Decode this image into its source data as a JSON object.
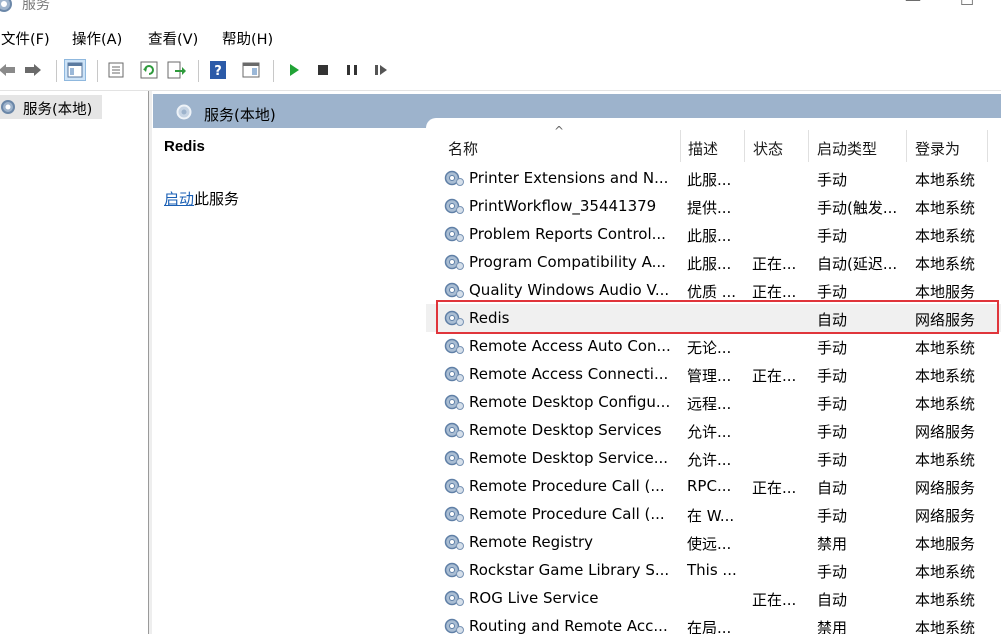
{
  "window": {
    "title": "服务"
  },
  "menu": [
    {
      "label": "文件(F)"
    },
    {
      "label": "操作(A)"
    },
    {
      "label": "查看(V)"
    },
    {
      "label": "帮助(H)"
    }
  ],
  "toolbar": {
    "buttons": [
      "back-icon",
      "forward-icon",
      "show-console-tree-icon",
      "properties-icon",
      "refresh-icon",
      "export-list-icon",
      "help-icon",
      "show-action-pane-icon",
      "start-service-icon",
      "stop-service-icon",
      "pause-service-icon",
      "resume-service-icon"
    ]
  },
  "tree": {
    "root_label": "服务(本地)"
  },
  "panel": {
    "header_title": "服务(本地)",
    "selected_service": "Redis",
    "start_link": "启动",
    "start_suffix": "此服务"
  },
  "columns": {
    "name": "名称",
    "desc": "描述",
    "status": "状态",
    "startup": "启动类型",
    "logon": "登录为"
  },
  "services": [
    {
      "name": "Printer Extensions and N...",
      "desc": "此服...",
      "status": "",
      "startup": "手动",
      "logon": "本地系统"
    },
    {
      "name": "PrintWorkflow_35441379",
      "desc": "提供...",
      "status": "",
      "startup": "手动(触发...",
      "logon": "本地系统"
    },
    {
      "name": "Problem Reports Control...",
      "desc": "此服...",
      "status": "",
      "startup": "手动",
      "logon": "本地系统"
    },
    {
      "name": "Program Compatibility A...",
      "desc": "此服...",
      "status": "正在...",
      "startup": "自动(延迟...",
      "logon": "本地系统"
    },
    {
      "name": "Quality Windows Audio V...",
      "desc": "优质 ...",
      "status": "正在...",
      "startup": "手动",
      "logon": "本地服务"
    },
    {
      "name": "Redis",
      "desc": "",
      "status": "",
      "startup": "自动",
      "logon": "网络服务"
    },
    {
      "name": "Remote Access Auto Con...",
      "desc": "无论...",
      "status": "",
      "startup": "手动",
      "logon": "本地系统"
    },
    {
      "name": "Remote Access Connecti...",
      "desc": "管理...",
      "status": "正在...",
      "startup": "手动",
      "logon": "本地系统"
    },
    {
      "name": "Remote Desktop Configu...",
      "desc": "远程...",
      "status": "",
      "startup": "手动",
      "logon": "本地系统"
    },
    {
      "name": "Remote Desktop Services",
      "desc": "允许...",
      "status": "",
      "startup": "手动",
      "logon": "网络服务"
    },
    {
      "name": "Remote Desktop Service...",
      "desc": "允许...",
      "status": "",
      "startup": "手动",
      "logon": "本地系统"
    },
    {
      "name": "Remote Procedure Call (...",
      "desc": "RPC...",
      "status": "正在...",
      "startup": "自动",
      "logon": "网络服务"
    },
    {
      "name": "Remote Procedure Call (...",
      "desc": "在 W...",
      "status": "",
      "startup": "手动",
      "logon": "网络服务"
    },
    {
      "name": "Remote Registry",
      "desc": "使远...",
      "status": "",
      "startup": "禁用",
      "logon": "本地服务"
    },
    {
      "name": "Rockstar Game Library S...",
      "desc": "This ...",
      "status": "",
      "startup": "手动",
      "logon": "本地系统"
    },
    {
      "name": "ROG Live Service",
      "desc": "",
      "status": "正在...",
      "startup": "自动",
      "logon": "本地系统"
    },
    {
      "name": "Routing and Remote Acc...",
      "desc": "在局...",
      "status": "",
      "startup": "禁用",
      "logon": "本地系统"
    }
  ],
  "colors": {
    "panel_header": "#9db3cc",
    "highlight": "#e0353b",
    "link": "#1a5fb4"
  }
}
